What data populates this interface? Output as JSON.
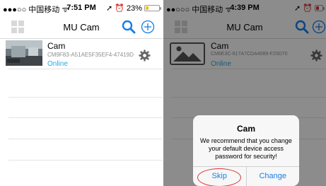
{
  "left_screen": {
    "status_bar": {
      "carrier": "●●●○○ 中国移动 ᯤ",
      "time": "7:51 PM",
      "right": "➚ ⏰ 23%",
      "battery_percent": 23
    },
    "nav": {
      "title": "MU Cam",
      "left_icon": "grid-icon",
      "search_icon": "search-icon",
      "add_icon": "add-icon"
    },
    "device": {
      "name": "Cam",
      "id": "CM9F83-A51AE5F35EF4-47419D",
      "status": "Online",
      "settings_icon": "gear-icon"
    }
  },
  "right_screen": {
    "status_bar": {
      "carrier": "●●○○○ 中国移动 ᯤ",
      "time": "4:39 PM",
      "right": "➚ ⏰"
    },
    "nav": {
      "title": "MU Cam",
      "left_icon": "grid-icon",
      "search_icon": "search-icon",
      "add_icon": "add-icon"
    },
    "device": {
      "name": "Cam",
      "id": "CM6E3C-617A7CDA4089-F25D70",
      "status": "Online",
      "settings_icon": "gear-icon"
    },
    "alert": {
      "title": "Cam",
      "message": "We recommend that you change your default device access password for security!",
      "skip": "Skip",
      "change": "Change"
    }
  },
  "colors": {
    "accent": "#1a7ee5",
    "online": "#2aa8e0",
    "annotation": "#e03030",
    "battery": "#f2c200"
  }
}
